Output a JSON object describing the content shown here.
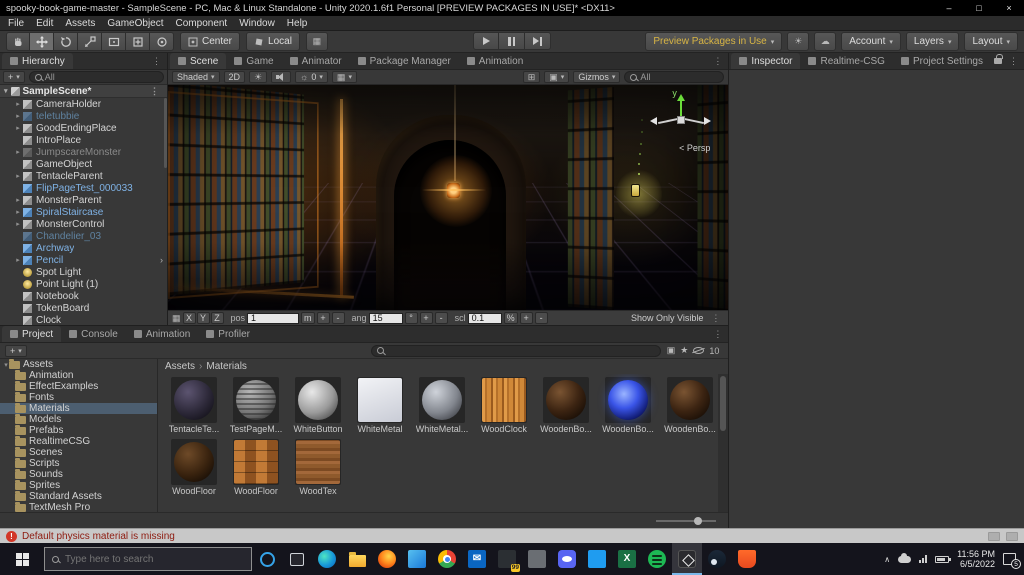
{
  "colors": {
    "selection_blue": "#2c5d87",
    "prefab_blue": "#7fb2e5",
    "preview_packages_yellow": "#d8b544",
    "error_red": "#d23727"
  },
  "icons": {
    "caret": "▾",
    "dots": "⋮",
    "sep": "›",
    "light": "☀",
    "audio": "♪",
    "effects": "☼",
    "grid": "▦",
    "tools": "⊞",
    "cube": "▣",
    "cloud": "☁",
    "sun": "☀",
    "star": "★",
    "chevron_up": "∧",
    "scene_expand": "▾"
  },
  "window": {
    "title": "spooky-book-game-master - SampleScene - PC, Mac & Linux Standalone - Unity 2020.1.6f1 Personal [PREVIEW PACKAGES IN USE]* <DX11>",
    "minimize": "–",
    "maximize": "□",
    "close": "×"
  },
  "menu": {
    "items": [
      {
        "label": "File"
      },
      {
        "label": "Edit"
      },
      {
        "label": "Assets"
      },
      {
        "label": "GameObject"
      },
      {
        "label": "Component"
      },
      {
        "label": "Window"
      },
      {
        "label": "Help"
      }
    ]
  },
  "toolbar": {
    "pivot": "Center",
    "space": "Local",
    "preview_packages": "Preview Packages in Use",
    "account": "Account",
    "layers": "Layers",
    "layout": "Layout"
  },
  "hierarchy": {
    "tab": "Hierarchy",
    "create": "+",
    "search": "All",
    "scene_name": "SampleScene*",
    "items": [
      {
        "name": "CameraHolder",
        "state": "st-normal",
        "icon": "cube",
        "arrow": "▸",
        "chev": ""
      },
      {
        "name": "teletubbie",
        "state": "st-pref-dim",
        "icon": "cube-blue-dim",
        "arrow": "▸",
        "chev": ""
      },
      {
        "name": "GoodEndingPlace",
        "state": "st-normal",
        "icon": "cube",
        "arrow": "▸",
        "chev": ""
      },
      {
        "name": "IntroPlace",
        "state": "st-normal",
        "icon": "cube",
        "arrow": "",
        "chev": ""
      },
      {
        "name": "JumpscareMonster",
        "state": "st-dis",
        "icon": "cube-dim",
        "arrow": "▸",
        "chev": ""
      },
      {
        "name": "GameObject",
        "state": "st-normal",
        "icon": "cube",
        "arrow": "",
        "chev": ""
      },
      {
        "name": "TentacleParent",
        "state": "st-normal",
        "icon": "cube",
        "arrow": "▸",
        "chev": ""
      },
      {
        "name": "FlipPageTest_000033",
        "state": "st-pref",
        "icon": "cube-blue",
        "arrow": "",
        "chev": ""
      },
      {
        "name": "MonsterParent",
        "state": "st-normal",
        "icon": "cube",
        "arrow": "▸",
        "chev": ""
      },
      {
        "name": "SpiralStaircase",
        "state": "st-pref",
        "icon": "cube-blue",
        "arrow": "▸",
        "chev": ""
      },
      {
        "name": "MonsterControl",
        "state": "st-normal",
        "icon": "cube",
        "arrow": "▸",
        "chev": ""
      },
      {
        "name": "Chandelier_03",
        "state": "st-pref-dim",
        "icon": "cube-blue-dim",
        "arrow": "",
        "chev": ""
      },
      {
        "name": "Archway",
        "state": "st-pref",
        "icon": "cube-blue",
        "arrow": "",
        "chev": ""
      },
      {
        "name": "Pencil",
        "state": "st-pref",
        "icon": "cube-blue",
        "arrow": "▸",
        "chev": "›"
      },
      {
        "name": "Spot Light",
        "state": "st-normal",
        "icon": "light",
        "arrow": "",
        "chev": ""
      },
      {
        "name": "Point Light (1)",
        "state": "st-normal",
        "icon": "light",
        "arrow": "",
        "chev": ""
      },
      {
        "name": "Notebook",
        "state": "st-normal",
        "icon": "cube",
        "arrow": "",
        "chev": ""
      },
      {
        "name": "TokenBoard",
        "state": "st-normal",
        "icon": "cube",
        "arrow": "",
        "chev": ""
      },
      {
        "name": "Clock",
        "state": "st-normal",
        "icon": "cube",
        "arrow": "",
        "chev": ""
      }
    ]
  },
  "scene_panel": {
    "tabs": [
      {
        "label": "Scene",
        "cls": "active"
      },
      {
        "label": "Game",
        "cls": ""
      },
      {
        "label": "Animator",
        "cls": ""
      },
      {
        "label": "Package Manager",
        "cls": ""
      },
      {
        "label": "Animation",
        "cls": ""
      }
    ],
    "shading": "Shaded",
    "toggle_2d": "2D",
    "effects_count": "0",
    "gizmos_label": "Gizmos",
    "search": "All",
    "gizmo_axis_label": "y",
    "gizmo_persp": "< Persp",
    "csg": {
      "axes": [
        {
          "label": "X"
        },
        {
          "label": "Y"
        },
        {
          "label": "Z"
        }
      ],
      "pos_label": "pos",
      "pos_value": "1",
      "pos_unit": "m",
      "ang_label": "ang",
      "ang_value": "15",
      "ang_unit": "°",
      "scl_label": "scl",
      "scl_value": "0.1",
      "scl_unit": "%",
      "plus": "+",
      "minus": "-",
      "show_only_visible": "Show Only Visible"
    }
  },
  "inspector": {
    "tabs": [
      {
        "label": "Inspector",
        "cls": "active"
      },
      {
        "label": "Realtime-CSG",
        "cls": ""
      },
      {
        "label": "Project Settings",
        "cls": ""
      }
    ]
  },
  "project": {
    "tabs": [
      {
        "label": "Project",
        "cls": "active"
      },
      {
        "label": "Console",
        "cls": ""
      },
      {
        "label": "Animation",
        "cls": ""
      },
      {
        "label": "Profiler",
        "cls": ""
      }
    ],
    "create": "+",
    "search": "",
    "hidden_count": "10",
    "folders": [
      {
        "name": "Assets",
        "arrow": "▾",
        "ind": "ind0",
        "sel": ""
      },
      {
        "name": "Animation",
        "arrow": "",
        "ind": "ind1",
        "sel": ""
      },
      {
        "name": "EffectExamples",
        "arrow": "▸",
        "ind": "ind1",
        "sel": ""
      },
      {
        "name": "Fonts",
        "arrow": "",
        "ind": "ind1",
        "sel": ""
      },
      {
        "name": "Materials",
        "arrow": "",
        "ind": "ind1",
        "sel": "selected"
      },
      {
        "name": "Models",
        "arrow": "▸",
        "ind": "ind1",
        "sel": ""
      },
      {
        "name": "Prefabs",
        "arrow": "▸",
        "ind": "ind1",
        "sel": ""
      },
      {
        "name": "RealtimeCSG",
        "arrow": "▸",
        "ind": "ind1",
        "sel": ""
      },
      {
        "name": "Scenes",
        "arrow": "",
        "ind": "ind1",
        "sel": ""
      },
      {
        "name": "Scripts",
        "arrow": "",
        "ind": "ind1",
        "sel": ""
      },
      {
        "name": "Sounds",
        "arrow": "",
        "ind": "ind1",
        "sel": ""
      },
      {
        "name": "Sprites",
        "arrow": "",
        "ind": "ind1",
        "sel": ""
      },
      {
        "name": "Standard Assets",
        "arrow": "▸",
        "ind": "ind1",
        "sel": ""
      },
      {
        "name": "TextMesh Pro",
        "arrow": "▸",
        "ind": "ind1",
        "sel": ""
      }
    ],
    "breadcrumb": {
      "root": "Assets",
      "sep": "›",
      "current": "Materials"
    },
    "materials": [
      {
        "label": "TentacleTe...",
        "cls": "th-sph-purple"
      },
      {
        "label": "TestPageM...",
        "cls": "th-sph-gray-text"
      },
      {
        "label": "WhiteButton",
        "cls": "th-sph-silver"
      },
      {
        "label": "WhiteMetal",
        "cls": "th-flat-white"
      },
      {
        "label": "WhiteMetal...",
        "cls": "th-sph-gray"
      },
      {
        "label": "WoodClock",
        "cls": "th-flat-woodclock"
      },
      {
        "label": "WoodenBo...",
        "cls": "th-sph-darkwood"
      },
      {
        "label": "WoodenBo...",
        "cls": "th-sph-blueglow"
      },
      {
        "label": "WoodenBo...",
        "cls": "th-sph-darkwood"
      },
      {
        "label": "WoodFloor",
        "cls": "th-sph-woodfloor"
      },
      {
        "label": "WoodFloor",
        "cls": "th-flat-parquet"
      },
      {
        "label": "WoodTex",
        "cls": "th-flat-woodtex"
      }
    ]
  },
  "status_bar": {
    "icon": "!",
    "message": "Default physics material is missing"
  },
  "taskbar": {
    "search_placeholder": "Type here to search",
    "icons": [
      {
        "icon_cls": "tb-cortana",
        "slot_cls": "",
        "glyph": "",
        "badge": "",
        "name": "cortana-icon"
      },
      {
        "icon_cls": "tb-taskview",
        "slot_cls": "",
        "glyph": "",
        "badge": "",
        "name": "task-view-icon"
      },
      {
        "icon_cls": "tb-edge",
        "slot_cls": "",
        "glyph": "",
        "badge": "",
        "name": "edge-browser-icon"
      },
      {
        "icon_cls": "tb-explorer",
        "slot_cls": "",
        "glyph": "",
        "badge": "",
        "name": "file-explorer-icon"
      },
      {
        "icon_cls": "tb-firefox",
        "slot_cls": "",
        "glyph": "",
        "badge": "",
        "name": "firefox-icon"
      },
      {
        "icon_cls": "tb-photos",
        "slot_cls": "",
        "glyph": "",
        "badge": "",
        "name": "photos-icon"
      },
      {
        "icon_cls": "tb-chrome",
        "slot_cls": "",
        "glyph": "",
        "badge": "",
        "name": "chrome-icon"
      },
      {
        "icon_cls": "tb-mail",
        "slot_cls": "",
        "glyph": "✉",
        "badge": "",
        "name": "mail-icon"
      },
      {
        "icon_cls": "tb-chat",
        "slot_cls": "",
        "glyph": "",
        "badge": "99",
        "name": "chat-app-icon"
      },
      {
        "icon_cls": "tb-launcher",
        "slot_cls": "",
        "glyph": "",
        "badge": "",
        "name": "app-launcher-icon"
      },
      {
        "icon_cls": "tb-discord",
        "slot_cls": "",
        "glyph": "",
        "badge": "",
        "name": "discord-icon"
      },
      {
        "icon_cls": "tb-vscode",
        "slot_cls": "",
        "glyph": "",
        "badge": "",
        "name": "code-editor-icon"
      },
      {
        "icon_cls": "tb-excel",
        "slot_cls": "",
        "glyph": "X",
        "badge": "",
        "name": "excel-icon"
      },
      {
        "icon_cls": "tb-spotify",
        "slot_cls": "",
        "glyph": "",
        "badge": "",
        "name": "spotify-icon"
      },
      {
        "icon_cls": "tb-unity",
        "slot_cls": "active",
        "glyph": "",
        "badge": "",
        "name": "unity-editor-icon"
      },
      {
        "icon_cls": "tb-steam",
        "slot_cls": "",
        "glyph": "",
        "badge": "",
        "name": "steam-icon"
      },
      {
        "icon_cls": "tb-brave",
        "slot_cls": "",
        "glyph": "",
        "badge": "",
        "name": "brave-browser-icon"
      }
    ],
    "tray": {
      "chevron": "∧",
      "time": "11:56 PM",
      "date": "6/5/2022",
      "notification_count": "5"
    }
  }
}
